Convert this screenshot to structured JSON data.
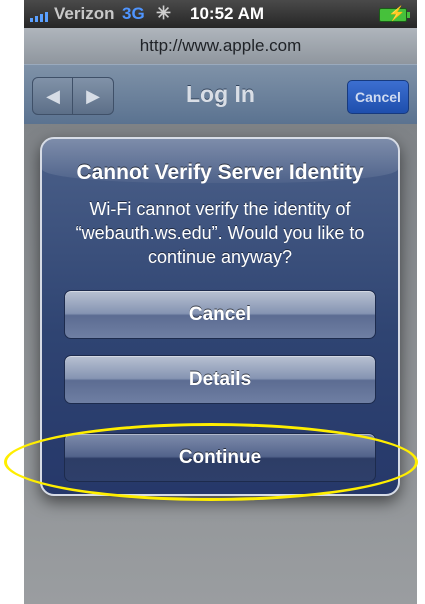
{
  "status_bar": {
    "carrier": "Verizon",
    "network": "3G",
    "activity_icon": "spinner-icon",
    "time": "10:52 AM",
    "battery_icon": "battery-charging-icon"
  },
  "browser": {
    "url": "http://www.apple.com"
  },
  "nav": {
    "back_icon": "◀",
    "forward_icon": "▶",
    "title": "Log In",
    "cancel_label": "Cancel"
  },
  "alert": {
    "title": "Cannot Verify Server Identity",
    "message": "Wi-Fi cannot verify the identity of “webauth.ws.edu”. Would you like to continue anyway?",
    "buttons": {
      "cancel": "Cancel",
      "details": "Details",
      "continue": "Continue"
    }
  },
  "annotation": {
    "color": "#ffee00",
    "target": "continue-button"
  },
  "colors": {
    "nav_bar": "#6b7f99",
    "alert_background": "#2f4472",
    "cancel_button": "#2a5cc0",
    "network_indicator": "#4f95ff",
    "battery": "#46c13b"
  }
}
